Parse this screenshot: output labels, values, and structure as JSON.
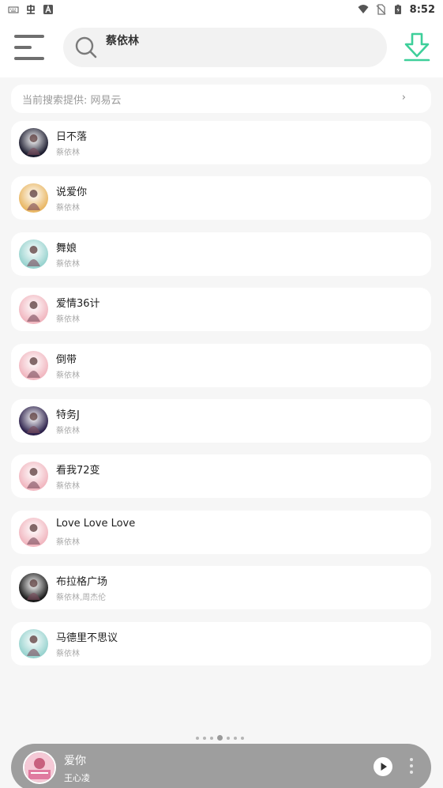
{
  "status_bar": {
    "time": "8:52",
    "icons": [
      "keyboard-icon",
      "app-icon",
      "text-icon",
      "wifi-icon",
      "no-sim-icon",
      "battery-icon"
    ]
  },
  "header": {
    "search_text": "蔡依林",
    "icons": [
      "menu-icon",
      "search-icon",
      "download-icon"
    ],
    "accent_color": "#3ecf9a"
  },
  "provider": {
    "label": "当前搜索提供: 网易云",
    "chevron": "›"
  },
  "songs": [
    {
      "title": "日不落",
      "artist": "蔡依林",
      "cover_color": "#1b1b2e"
    },
    {
      "title": "说爱你",
      "artist": "蔡依林",
      "cover_color": "#e9b764"
    },
    {
      "title": "舞娘",
      "artist": "蔡依林",
      "cover_color": "#98d3cf"
    },
    {
      "title": "爱情36计",
      "artist": "蔡依林",
      "cover_color": "#f1b7c0"
    },
    {
      "title": "倒带",
      "artist": "蔡依林",
      "cover_color": "#f1b7c0"
    },
    {
      "title": "特务J",
      "artist": "蔡依林",
      "cover_color": "#2b1f4a"
    },
    {
      "title": "看我72变",
      "artist": "蔡依林",
      "cover_color": "#f1b7c0"
    },
    {
      "title": "Love Love Love",
      "artist": "蔡依林",
      "cover_color": "#f1b7c0"
    },
    {
      "title": "布拉格广场",
      "artist": "蔡依林,周杰伦",
      "cover_color": "#1a1a1a"
    },
    {
      "title": "马德里不思议",
      "artist": "蔡依林",
      "cover_color": "#98d3cf"
    }
  ],
  "pager": {
    "count": 7,
    "active": 3
  },
  "player": {
    "title": "爱你",
    "artist": "王心凌",
    "background": "#9e9e9e"
  }
}
